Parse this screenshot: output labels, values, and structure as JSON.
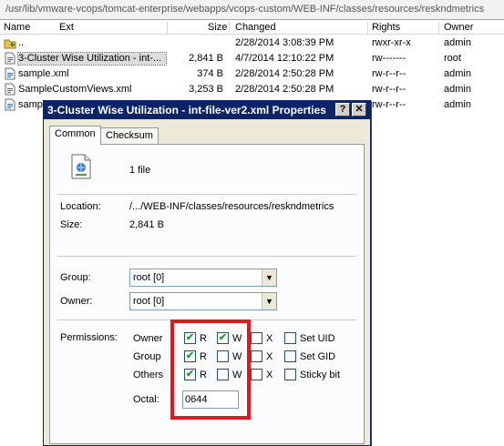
{
  "path_bar": {
    "path": "/usr/lib/vmware-vcops/tomcat-enterprise/webapps/vcops-custom/WEB-INF/classes/resources/reskndmetrics"
  },
  "columns": {
    "name": "Name",
    "ext": "Ext",
    "size": "Size",
    "changed": "Changed",
    "rights": "Rights",
    "owner": "Owner"
  },
  "files": [
    {
      "icon": "parent-folder-icon",
      "name": "..",
      "size": "",
      "changed": "2/28/2014 3:08:39 PM",
      "rights": "rwxr-xr-x",
      "owner": "admin"
    },
    {
      "icon": "xml-file-icon",
      "name": "3-Cluster Wise Utilization - int-...",
      "size": "2,841 B",
      "changed": "4/7/2014 12:10:22 PM",
      "rights": "rw-------",
      "owner": "root"
    },
    {
      "icon": "xml-file-icon",
      "name": "sample.xml",
      "size": "374 B",
      "changed": "2/28/2014 2:50:28 PM",
      "rights": "rw-r--r--",
      "owner": "admin"
    },
    {
      "icon": "xml-file-icon",
      "name": "SampleCustomViews.xml",
      "size": "3,253 B",
      "changed": "2/28/2014 2:50:28 PM",
      "rights": "rw-r--r--",
      "owner": "admin"
    },
    {
      "icon": "xml-file-icon",
      "name": "samp",
      "size": "",
      "changed": "",
      "rights": "rw-r--r--",
      "owner": "admin"
    }
  ],
  "dialog": {
    "title": "3-Cluster Wise Utilization - int-file-ver2.xml Properties",
    "help_label": "?",
    "close_label": "✕",
    "tabs": [
      "Common",
      "Checksum"
    ],
    "file_count": "1 file",
    "location_label": "Location:",
    "location_value": "/.../WEB-INF/classes/resources/reskndmetrics",
    "size_label": "Size:",
    "size_value": "2,841 B",
    "group_label": "Group:",
    "group_value": "root [0]",
    "owner_label": "Owner:",
    "owner_value": "root [0]",
    "permissions_label": "Permissions:",
    "perm_rows": [
      {
        "label": "Owner",
        "r": true,
        "w": true,
        "x": false,
        "special": "Set UID",
        "special_checked": false
      },
      {
        "label": "Group",
        "r": true,
        "w": false,
        "x": false,
        "special": "Set GID",
        "special_checked": false
      },
      {
        "label": "Others",
        "r": true,
        "w": false,
        "x": false,
        "special": "Sticky bit",
        "special_checked": false
      }
    ],
    "r_label": "R",
    "w_label": "W",
    "x_label": "X",
    "octal_label": "Octal:",
    "octal_value": "0644"
  },
  "colors": {
    "titlebar": "#0a246a",
    "highlight": "#e0191e",
    "check": "#21a121"
  }
}
